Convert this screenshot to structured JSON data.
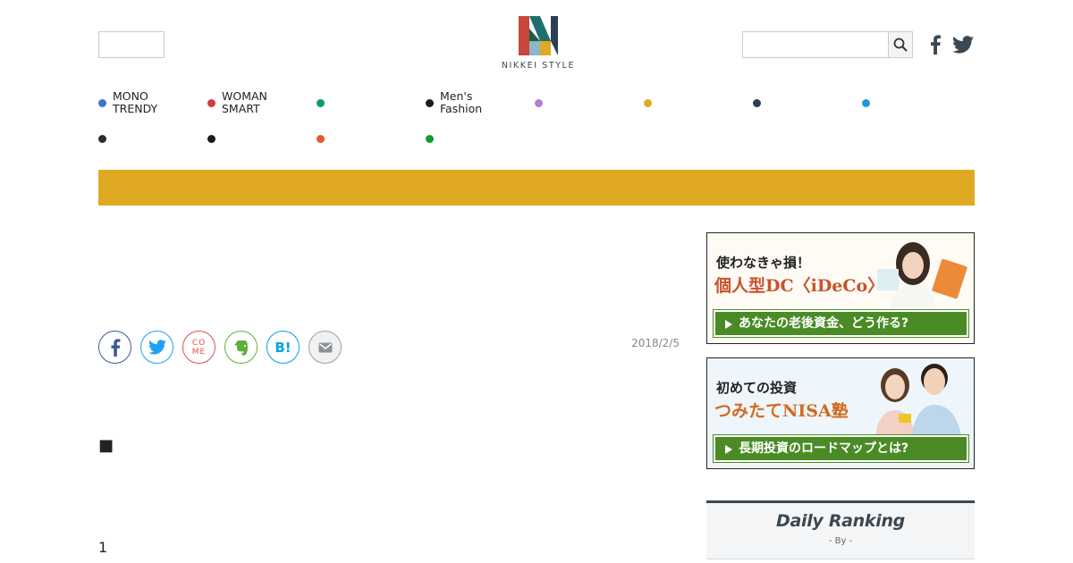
{
  "header": {
    "logo_text": "NIKKEI STYLE",
    "search_placeholder": ""
  },
  "nav": {
    "items": [
      {
        "label_line1": "MONO",
        "label_line2": "TRENDY",
        "color": "#3a78c9"
      },
      {
        "label_line1": "WOMAN",
        "label_line2": "SMART",
        "color": "#d23b3b"
      },
      {
        "label_line1": "",
        "label_line2": "",
        "color": "#119a6f"
      },
      {
        "label_line1": "Men's",
        "label_line2": "Fashion",
        "color": "#1b1b1b"
      },
      {
        "label_line1": "",
        "label_line2": "",
        "color": "#b27bd9"
      },
      {
        "label_line1": "",
        "label_line2": "",
        "color": "#e0a922"
      },
      {
        "label_line1": "",
        "label_line2": "",
        "color": "#2f3c58"
      },
      {
        "label_line1": "",
        "label_line2": "",
        "color": "#1e9ad6"
      },
      {
        "label_line1": "",
        "label_line2": "",
        "color": "#2b2b2b"
      },
      {
        "label_line1": "",
        "label_line2": "",
        "color": "#1b1b1b"
      },
      {
        "label_line1": "",
        "label_line2": "",
        "color": "#e05a2b"
      },
      {
        "label_line1": "",
        "label_line2": "",
        "color": "#129a2c"
      }
    ]
  },
  "banner_color": "#e0a922",
  "article": {
    "date": "2018/2/5",
    "bullet": "■",
    "page_number": "1"
  },
  "share": {
    "buttons": [
      "facebook-icon",
      "twitter-icon",
      "come-icon",
      "evernote-icon",
      "hatena-icon",
      "mail-icon"
    ],
    "come_text": "CO ME",
    "hatena_text": "B!"
  },
  "ads": [
    {
      "head": "使わなきゃ損！",
      "title": "個人型DC〈iDeCo〉",
      "cta": "あなたの老後資金、どう作る?"
    },
    {
      "head": "初めての投資",
      "title": "つみたてNISA塾",
      "cta": "長期投資のロードマップとは?"
    }
  ],
  "ranking": {
    "title": "Daily Ranking",
    "by": "- By -"
  }
}
